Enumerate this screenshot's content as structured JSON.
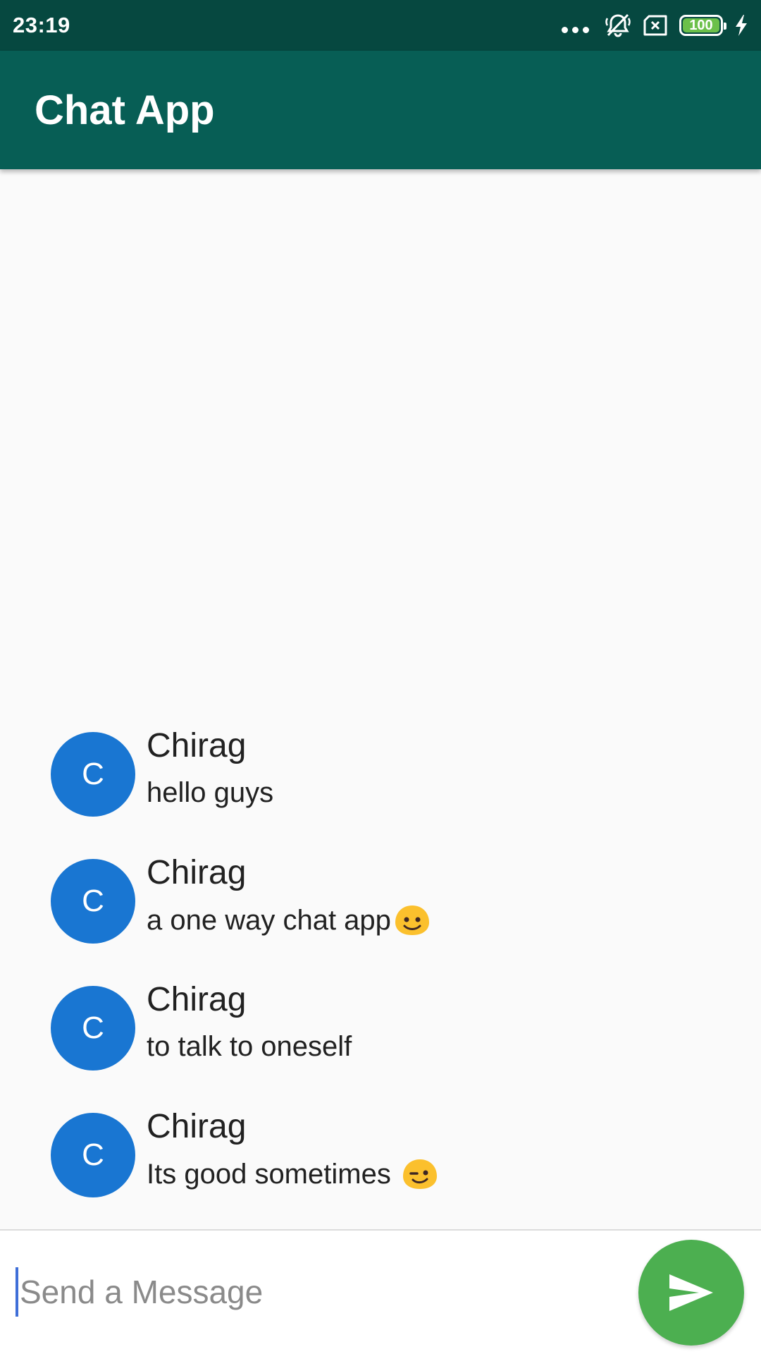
{
  "status_bar": {
    "time": "23:19",
    "battery": "100",
    "icons": [
      "more-dots-icon",
      "notifications-off-icon",
      "sim-error-icon",
      "battery-icon",
      "charging-bolt-icon"
    ]
  },
  "app_bar": {
    "title": "Chat App"
  },
  "messages": [
    {
      "avatar_letter": "C",
      "sender": "Chirag",
      "text": "hello guys",
      "emoji": ""
    },
    {
      "avatar_letter": "C",
      "sender": "Chirag",
      "text": "a one way chat app",
      "emoji": "slightly-smiling-face"
    },
    {
      "avatar_letter": "C",
      "sender": "Chirag",
      "text": "to talk to oneself",
      "emoji": ""
    },
    {
      "avatar_letter": "C",
      "sender": "Chirag",
      "text": "Its good sometimes ",
      "emoji": "winking-face"
    }
  ],
  "composer": {
    "placeholder": "Send a Message",
    "value": ""
  },
  "colors": {
    "status_bar": "#064840",
    "app_bar": "#075e55",
    "avatar": "#1976d2",
    "send_button": "#4caf50",
    "background": "#fafafa"
  }
}
